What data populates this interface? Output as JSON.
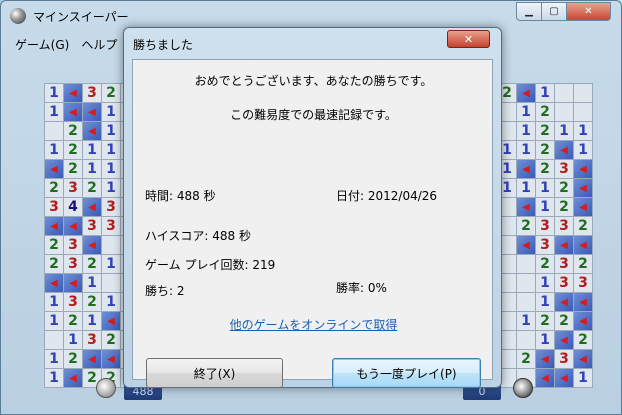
{
  "window": {
    "title": "マインスイーパー",
    "menu": [
      "ゲーム(G)",
      "ヘルプ"
    ],
    "timer": "488",
    "mines_left": "0"
  },
  "board_left": [
    [
      "1",
      "F",
      "3",
      "2",
      ""
    ],
    [
      "1",
      "F",
      "F",
      "1",
      ""
    ],
    [
      "",
      "2",
      "F",
      "1",
      ""
    ],
    [
      "1",
      "2",
      "1",
      "1",
      ""
    ],
    [
      "F",
      "2",
      "1",
      "1",
      ""
    ],
    [
      "2",
      "3",
      "2",
      "1",
      ""
    ],
    [
      "3",
      "4",
      "F",
      "3",
      ""
    ],
    [
      "F",
      "F",
      "3",
      "3",
      ""
    ],
    [
      "2",
      "3",
      "F",
      "",
      ""
    ],
    [
      "2",
      "3",
      "2",
      "1",
      ""
    ],
    [
      "F",
      "F",
      "1",
      "",
      ""
    ],
    [
      "1",
      "3",
      "2",
      "1",
      ""
    ],
    [
      "1",
      "2",
      "1",
      "F",
      ""
    ],
    [
      "",
      "1",
      "3",
      "2",
      ""
    ],
    [
      "1",
      "2",
      "F",
      "F",
      ""
    ],
    [
      "1",
      "F",
      "2",
      "2",
      ""
    ]
  ],
  "board_right": [
    [
      "2",
      "F",
      "1",
      "",
      ""
    ],
    [
      "",
      "1",
      "2",
      "",
      ""
    ],
    [
      "",
      "1",
      "2",
      "1",
      "1"
    ],
    [
      "1",
      "1",
      "2",
      "F",
      "1"
    ],
    [
      "1",
      "F",
      "2",
      "3",
      "F"
    ],
    [
      "1",
      "1",
      "1",
      "2",
      "F"
    ],
    [
      "",
      "F",
      "1",
      "2",
      "F"
    ],
    [
      "",
      "2",
      "3",
      "3",
      "2"
    ],
    [
      "",
      "F",
      "3",
      "F",
      "F"
    ],
    [
      "",
      "",
      "2",
      "3",
      "2"
    ],
    [
      "",
      "",
      "1",
      "3",
      "3"
    ],
    [
      "",
      "",
      "1",
      "F",
      "F"
    ],
    [
      "",
      "1",
      "2",
      "2",
      "F"
    ],
    [
      "",
      "",
      "1",
      "F",
      "2"
    ],
    [
      "",
      "2",
      "F",
      "3",
      "F"
    ],
    [
      "",
      "",
      "F",
      "F",
      "1"
    ]
  ],
  "dialog": {
    "title": "勝ちました",
    "close_label": "✕",
    "congrats": "おめでとうございます、あなたの勝ちです。",
    "record": "この難易度での最速記録です。",
    "time": "時間: 488 秒",
    "date": "日付: 2012/04/26",
    "high_score": "ハイスコア: 488 秒",
    "games_played": "ゲーム プレイ回数: 219",
    "wins": "勝ち: 2",
    "win_rate": "勝率: 0%",
    "online_link": "他のゲームをオンラインで取得",
    "exit_button": "終了(X)",
    "play_again_button": "もう一度プレイ(P)"
  }
}
